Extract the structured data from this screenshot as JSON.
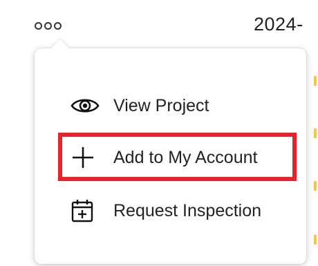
{
  "header": {
    "more_icon": "more-horizontal-dots-icon",
    "date_text": "2024-"
  },
  "menu": {
    "items": [
      {
        "label": "View Project",
        "icon": "eye-icon"
      },
      {
        "label": "Add to My Account",
        "icon": "plus-icon"
      },
      {
        "label": "Request Inspection",
        "icon": "calendar-plus-icon"
      }
    ]
  },
  "colors": {
    "highlight": "#e8232c",
    "accent": "#f5c64a",
    "text": "#222222"
  }
}
